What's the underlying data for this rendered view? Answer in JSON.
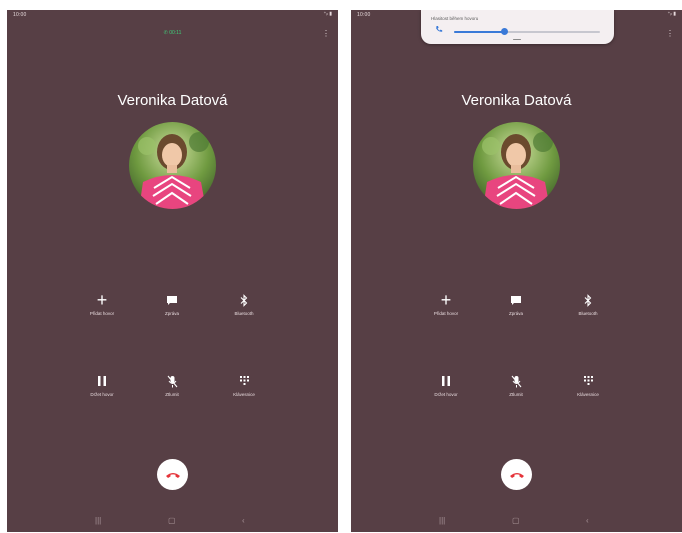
{
  "status": {
    "time": "10:00",
    "right_icons": "⁺ᵢₗ ▮"
  },
  "call": {
    "caller_name": "Veronika Datová",
    "duration": "00:11"
  },
  "actions": {
    "add_call": "Přidat hovor",
    "message": "Zpráva",
    "bluetooth": "Bluetooth",
    "hold": "Držet hovor",
    "mute": "Ztlumit",
    "keypad": "Klávesnice"
  },
  "volume": {
    "title": "Hlasitost během hovoru",
    "level": 0.34,
    "accent": "#3a7ad8"
  },
  "colors": {
    "background": "#573f45",
    "end_call": "#e5343a",
    "duration": "#3fcf7a"
  },
  "icons": {
    "menu": "more-vertical-icon",
    "add": "plus-icon",
    "message": "message-bubble-icon",
    "bluetooth": "bluetooth-icon",
    "hold": "pause-icon",
    "mute": "mic-off-icon",
    "keypad": "dialpad-icon",
    "end_call": "phone-end-icon",
    "nav_recents": "recents-icon",
    "nav_home": "home-icon",
    "nav_back": "back-icon"
  }
}
